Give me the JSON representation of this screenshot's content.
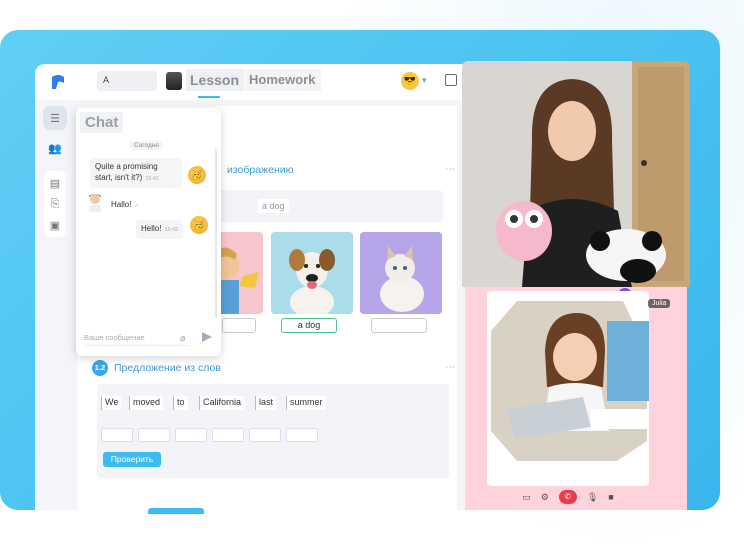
{
  "colors": {
    "frame": "#45c0ef",
    "accent": "#3cbbee",
    "hangup": "#ee3b4b",
    "correct": "#48c38e"
  },
  "topbar": {
    "search_value": "А",
    "tabs": [
      {
        "label": "Lesson"
      },
      {
        "label": "Homework"
      }
    ]
  },
  "sidebar": {
    "icons": [
      "menu-icon",
      "users-icon",
      "chat-icon",
      "translate-icon",
      "notes-icon"
    ]
  },
  "exercise1": {
    "title": "изображению",
    "word": "a dog",
    "answers": [
      "",
      "a dog",
      ""
    ]
  },
  "exercise2": {
    "number": "1.2",
    "title": "Предложение из слов",
    "words": [
      "We",
      "moved",
      "to",
      "California",
      "last",
      "summer"
    ],
    "check_label": "Проверить"
  },
  "chat": {
    "title": "Chat",
    "date": "Сегодня",
    "messages": [
      {
        "text": "Quite a promising start, isn't it?)",
        "time": "15:41"
      },
      {
        "text": "Hallo!",
        "time": "✓"
      },
      {
        "text": "Hello!",
        "time": "15:42"
      }
    ],
    "input_placeholder": "Ваше сообщение"
  },
  "video": {
    "student_name": "Julia"
  }
}
